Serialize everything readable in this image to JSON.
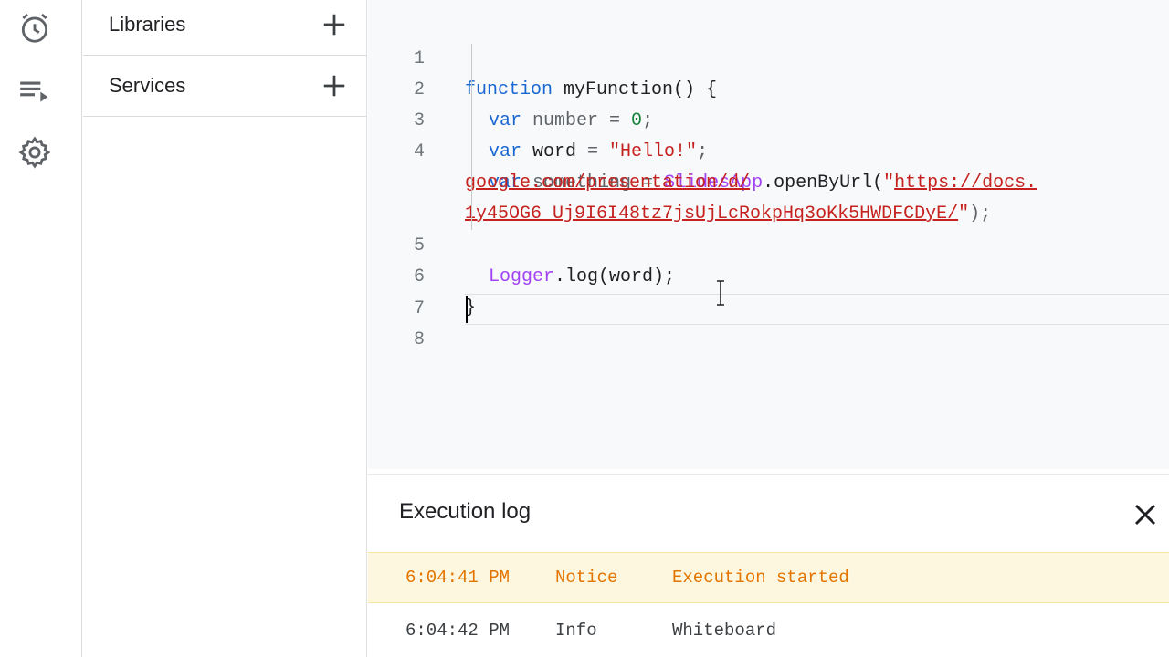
{
  "rail": {
    "icons": [
      "alarm-clock-icon",
      "playlist-play-icon",
      "gear-icon"
    ]
  },
  "panel": {
    "libraries_label": "Libraries",
    "services_label": "Services"
  },
  "editor": {
    "line_numbers": [
      "1",
      "2",
      "3",
      "4",
      "5",
      "6",
      "7",
      "8"
    ],
    "line1": {
      "kw": "function",
      "rest": " myFunction() {"
    },
    "line2": {
      "kw": "var",
      "ident": " number",
      "op": " = ",
      "num": "0",
      "end": ";"
    },
    "line3": {
      "kw": "var",
      "ident": " word",
      "op": " = ",
      "str": "\"Hello!\"",
      "end": ";"
    },
    "line4": {
      "kw": "var",
      "ident": " something",
      "op": " = ",
      "cls": "SlidesApp",
      "method": ".openByUrl(",
      "quote_open": "\"",
      "url_part1": "https://docs.",
      "url_part2": "google.com/presentation/d/",
      "url_part3": "1y45OG6_Uj9I6I48tz7jsUjLcRokpHq3oKk5HWDFCDyE/",
      "quote_close": "\"",
      "end": ");"
    },
    "line5": {
      "cls": "Logger",
      "rest": ".log(word);"
    },
    "line6": {
      "rest": "}"
    }
  },
  "exec_log": {
    "title": "Execution log",
    "rows": [
      {
        "time": "6:04:41 PM",
        "level": "Notice",
        "message": "Execution started"
      },
      {
        "time": "6:04:42 PM",
        "level": "Info",
        "message": "Whiteboard"
      }
    ]
  },
  "colors": {
    "keyword": "#1967d2",
    "string": "#c5221f",
    "number": "#188038",
    "class": "#a142f4",
    "notice_bg": "#fef7e0",
    "notice_text": "#e37400"
  }
}
